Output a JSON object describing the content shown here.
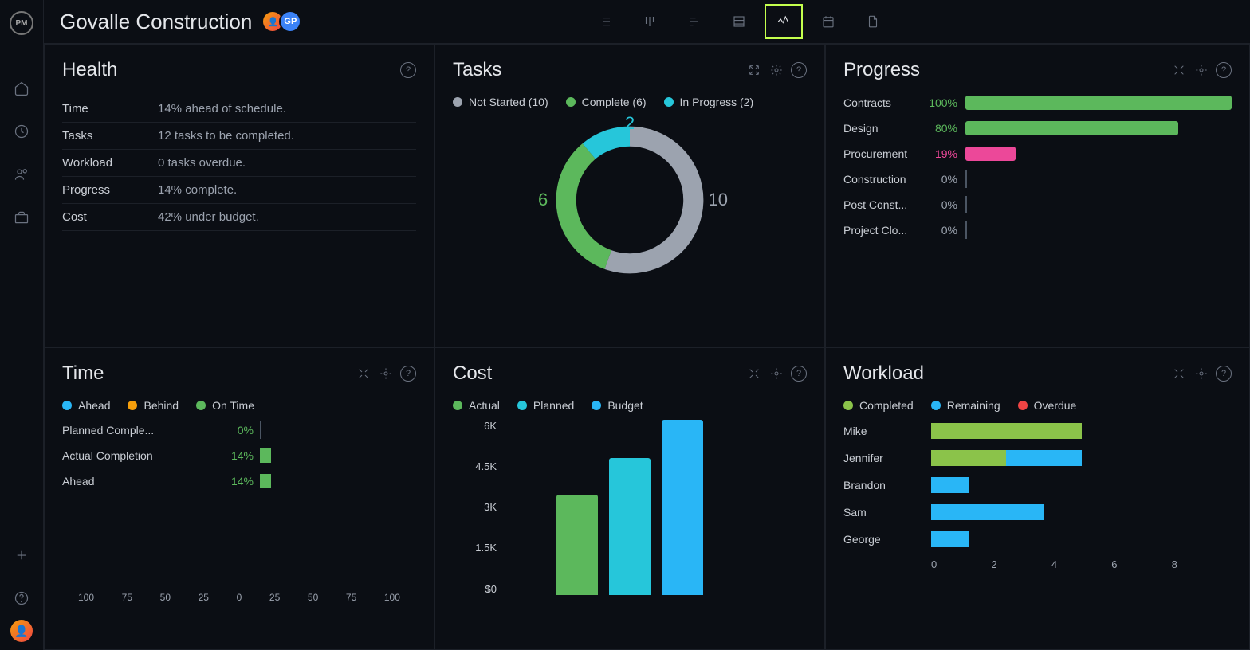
{
  "header": {
    "title": "Govalle Construction",
    "avatars": [
      {
        "initials": "👤"
      },
      {
        "initials": "GP"
      }
    ]
  },
  "colors": {
    "green": "#5cb85c",
    "teal": "#26c6da",
    "blue": "#29b6f6",
    "gray": "#9ca3af",
    "orange": "#f59e0b",
    "pink": "#ec4899",
    "lime": "#8bc34a",
    "red": "#ef4444"
  },
  "panels": {
    "health": {
      "title": "Health",
      "rows": [
        {
          "label": "Time",
          "value": "14% ahead of schedule."
        },
        {
          "label": "Tasks",
          "value": "12 tasks to be completed."
        },
        {
          "label": "Workload",
          "value": "0 tasks overdue."
        },
        {
          "label": "Progress",
          "value": "14% complete."
        },
        {
          "label": "Cost",
          "value": "42% under budget."
        }
      ]
    },
    "tasks": {
      "title": "Tasks",
      "legend": [
        {
          "label": "Not Started (10)",
          "color": "#9ca3af"
        },
        {
          "label": "Complete (6)",
          "color": "#5cb85c"
        },
        {
          "label": "In Progress (2)",
          "color": "#26c6da"
        }
      ],
      "donut_labels": {
        "top": "2",
        "left": "6",
        "right": "10"
      }
    },
    "progress": {
      "title": "Progress",
      "rows": [
        {
          "label": "Contracts",
          "pct": "100%",
          "val": 100,
          "color": "#5cb85c"
        },
        {
          "label": "Design",
          "pct": "80%",
          "val": 80,
          "color": "#5cb85c"
        },
        {
          "label": "Procurement",
          "pct": "19%",
          "val": 19,
          "color": "#ec4899"
        },
        {
          "label": "Construction",
          "pct": "0%",
          "val": 0,
          "color": null
        },
        {
          "label": "Post Const...",
          "pct": "0%",
          "val": 0,
          "color": null
        },
        {
          "label": "Project Clo...",
          "pct": "0%",
          "val": 0,
          "color": null
        }
      ]
    },
    "time": {
      "title": "Time",
      "legend": [
        {
          "label": "Ahead",
          "color": "#29b6f6"
        },
        {
          "label": "Behind",
          "color": "#f59e0b"
        },
        {
          "label": "On Time",
          "color": "#5cb85c"
        }
      ],
      "rows": [
        {
          "label": "Planned Comple...",
          "pct": "0%",
          "val": 0
        },
        {
          "label": "Actual Completion",
          "pct": "14%",
          "val": 14
        },
        {
          "label": "Ahead",
          "pct": "14%",
          "val": 14
        }
      ],
      "axis": [
        "100",
        "75",
        "50",
        "25",
        "0",
        "25",
        "50",
        "75",
        "100"
      ]
    },
    "cost": {
      "title": "Cost",
      "legend": [
        {
          "label": "Actual",
          "color": "#5cb85c"
        },
        {
          "label": "Planned",
          "color": "#26c6da"
        },
        {
          "label": "Budget",
          "color": "#29b6f6"
        }
      ],
      "yaxis": [
        "6K",
        "4.5K",
        "3K",
        "1.5K",
        "$0"
      ]
    },
    "workload": {
      "title": "Workload",
      "legend": [
        {
          "label": "Completed",
          "color": "#8bc34a"
        },
        {
          "label": "Remaining",
          "color": "#29b6f6"
        },
        {
          "label": "Overdue",
          "color": "#ef4444"
        }
      ],
      "rows": [
        {
          "label": "Mike",
          "completed": 4,
          "remaining": 0
        },
        {
          "label": "Jennifer",
          "completed": 2,
          "remaining": 2
        },
        {
          "label": "Brandon",
          "completed": 0,
          "remaining": 1
        },
        {
          "label": "Sam",
          "completed": 0,
          "remaining": 3
        },
        {
          "label": "George",
          "completed": 0,
          "remaining": 1
        }
      ],
      "axis": [
        "0",
        "2",
        "4",
        "6",
        "8"
      ]
    }
  },
  "chart_data": [
    {
      "type": "pie",
      "panel": "tasks",
      "categories": [
        "Not Started",
        "Complete",
        "In Progress"
      ],
      "values": [
        10,
        6,
        2
      ]
    },
    {
      "type": "bar",
      "panel": "progress",
      "categories": [
        "Contracts",
        "Design",
        "Procurement",
        "Construction",
        "Post Construction",
        "Project Closeout"
      ],
      "values": [
        100,
        80,
        19,
        0,
        0,
        0
      ],
      "ylabel": "%",
      "ylim": [
        0,
        100
      ]
    },
    {
      "type": "bar",
      "panel": "time",
      "categories": [
        "Planned Completion",
        "Actual Completion",
        "Ahead"
      ],
      "values": [
        0,
        14,
        14
      ],
      "xlabel": "%",
      "xlim": [
        -100,
        100
      ]
    },
    {
      "type": "bar",
      "panel": "cost",
      "categories": [
        "Actual",
        "Planned",
        "Budget"
      ],
      "values": [
        3400,
        4700,
        6000
      ],
      "ylabel": "$",
      "ylim": [
        0,
        6000
      ]
    },
    {
      "type": "bar",
      "panel": "workload",
      "categories": [
        "Mike",
        "Jennifer",
        "Brandon",
        "Sam",
        "George"
      ],
      "series": [
        {
          "name": "Completed",
          "values": [
            4,
            2,
            0,
            0,
            0
          ]
        },
        {
          "name": "Remaining",
          "values": [
            0,
            2,
            1,
            3,
            1
          ]
        }
      ],
      "xlim": [
        0,
        8
      ]
    }
  ]
}
